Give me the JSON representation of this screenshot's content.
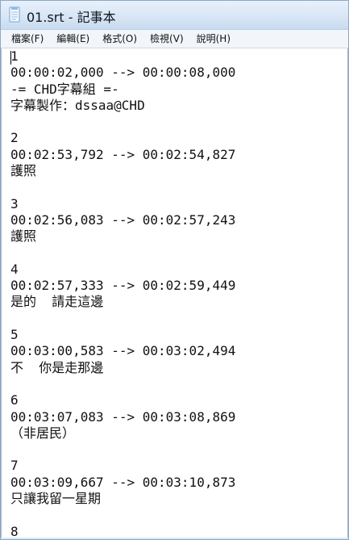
{
  "window": {
    "title": "01.srt - 記事本"
  },
  "menu": {
    "items": [
      "檔案(F)",
      "編輯(E)",
      "格式(O)",
      "檢視(V)",
      "說明(H)"
    ]
  },
  "editor": {
    "text": "1\n00:00:02,000 --> 00:00:08,000\n-= CHD字幕組 =-\n字幕製作：dssaa@CHD\n\n2\n00:02:53,792 --> 00:02:54,827\n護照\n\n3\n00:02:56,083 --> 00:02:57,243\n護照\n\n4\n00:02:57,333 --> 00:02:59,449\n是的  請走這邊\n\n5\n00:03:00,583 --> 00:03:02,494\n不  你是走那邊\n\n6\n00:03:07,083 --> 00:03:08,869\n（非居民）\n\n7\n00:03:09,667 --> 00:03:10,873\n只讓我留一星期\n\n8"
  },
  "icons": {
    "app_icon": "notepad-icon"
  }
}
